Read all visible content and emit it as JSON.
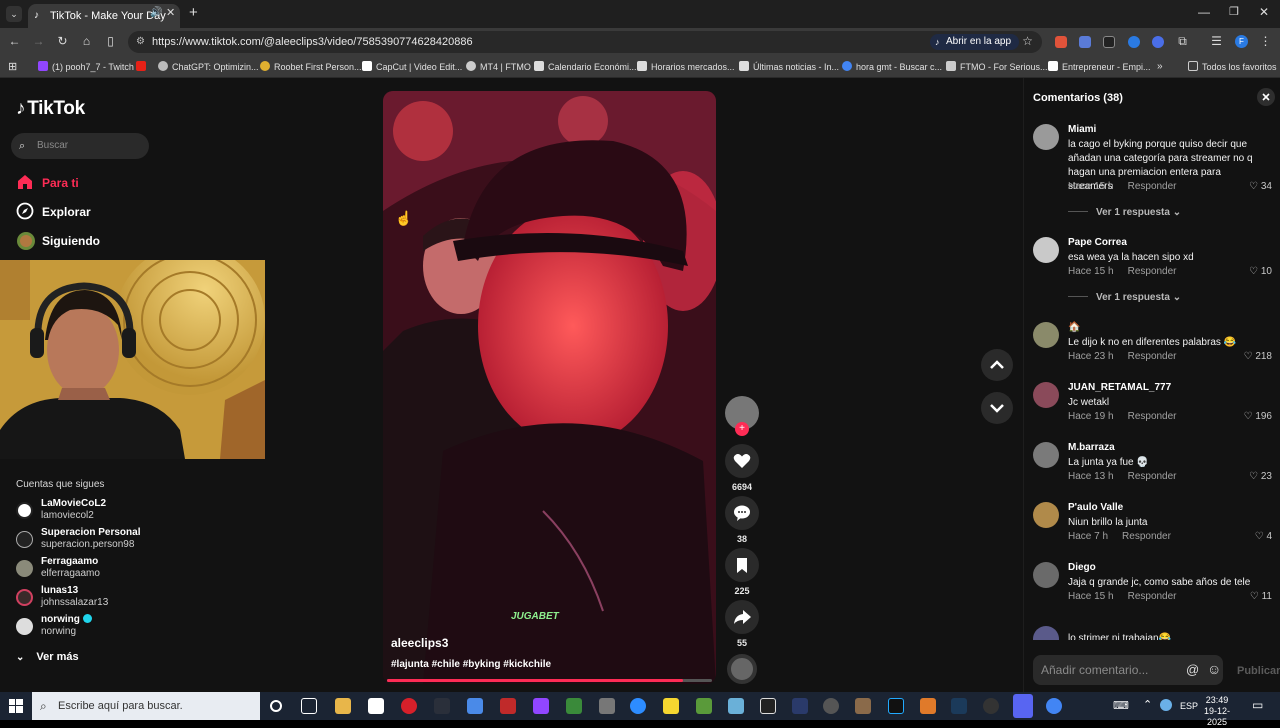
{
  "browser": {
    "tab_title": "TikTok - Make Your Day",
    "url": "https://www.tiktok.com/@aleeclips3/video/7585390774628420886",
    "open_app_label": "Abrir en la app",
    "bookmarks": [
      {
        "label": "(1) pooh7_7 - Twitch",
        "color": "#9146ff"
      },
      {
        "label": "ChatGPT: Optimizin...",
        "color": "#cccccc"
      },
      {
        "label": "Roobet First Person...",
        "color": "#e0b030"
      },
      {
        "label": "CapCut | Video Edit...",
        "color": "#ffffff"
      },
      {
        "label": "MT4 | FTMO",
        "color": "#cccccc"
      },
      {
        "label": "Calendario Económi...",
        "color": "#dddddd"
      },
      {
        "label": "Horarios mercados...",
        "color": "#dddddd"
      },
      {
        "label": "Últimas noticias - In...",
        "color": "#dddddd"
      },
      {
        "label": "hora gmt - Buscar c...",
        "color": "#4285f4"
      },
      {
        "label": "FTMO - For Serious...",
        "color": "#cccccc"
      },
      {
        "label": "Entrepreneur - Empi...",
        "color": "#ffffff"
      }
    ],
    "all_favorites_label": "Todos los favoritos"
  },
  "sidebar": {
    "logo": "TikTok",
    "search_placeholder": "Buscar",
    "nav": [
      {
        "label": "Para ti",
        "icon": "home-icon",
        "active": true
      },
      {
        "label": "Explorar",
        "icon": "compass-icon",
        "active": false
      },
      {
        "label": "Siguiendo",
        "icon": "following-icon",
        "active": false
      }
    ],
    "following_heading": "Cuentas que sigues",
    "accounts": [
      {
        "name": "LaMovieCoL2",
        "handle": "lamoviecol2"
      },
      {
        "name": "Superacion Personal",
        "handle": "superacion.person98"
      },
      {
        "name": "Ferragaamo",
        "handle": "elferragaamo"
      },
      {
        "name": "lunas13",
        "handle": "johnssalazar13"
      },
      {
        "name": "norwing",
        "handle": "norwing",
        "verified": true
      }
    ],
    "see_more": "Ver más"
  },
  "video": {
    "author": "aleeclips3",
    "hashtags": "#lajunta #chile #byking #kickchile",
    "sponsor_watermark": "JUGABET",
    "progress": 0.91
  },
  "actions": {
    "likes": "6694",
    "comments": "38",
    "saves": "225",
    "shares": "55"
  },
  "comments": {
    "title": "Comentarios (38)",
    "input_placeholder": "Añadir comentario...",
    "post_label": "Publicar",
    "reply_label": "Responder",
    "items": [
      {
        "user": "Miami",
        "text": "la cago el byking porque quiso decir que añadan una categoría para streamer no q hagan una premiacion entera para streamers",
        "time": "Hace 15 h",
        "likes": "34",
        "replies": "Ver 1 respuesta"
      },
      {
        "user": "Pape Correa",
        "text": "esa wea ya la hacen sipo xd",
        "time": "Hace 15 h",
        "likes": "10",
        "replies": "Ver 1 respuesta"
      },
      {
        "user": "🏠",
        "text": "Le dijo k no en diferentes palabras 😂",
        "time": "Hace 23 h",
        "likes": "218"
      },
      {
        "user": "JUAN_RETAMAL_777",
        "text": "Jc wetakl",
        "time": "Hace 19 h",
        "likes": "196"
      },
      {
        "user": "M.barraza",
        "text": "La junta ya fue 💀",
        "time": "Hace 13 h",
        "likes": "23"
      },
      {
        "user": "P'aulo Valle",
        "text": "Niun brillo la junta",
        "time": "Hace 7 h",
        "likes": "4"
      },
      {
        "user": "Diego",
        "text": "Jaja q grande jc, como sabe años de tele",
        "time": "Hace 15 h",
        "likes": "11"
      },
      {
        "user": "",
        "text": "lo strimer ni trabajan😂",
        "time": "",
        "likes": ""
      }
    ]
  },
  "taskbar": {
    "search_placeholder": "Escribe aquí para buscar.",
    "language": "ESP",
    "time": "23:49",
    "date": "19-12-2025"
  },
  "colors": {
    "accent": "#fe2c55",
    "background": "#121212"
  }
}
